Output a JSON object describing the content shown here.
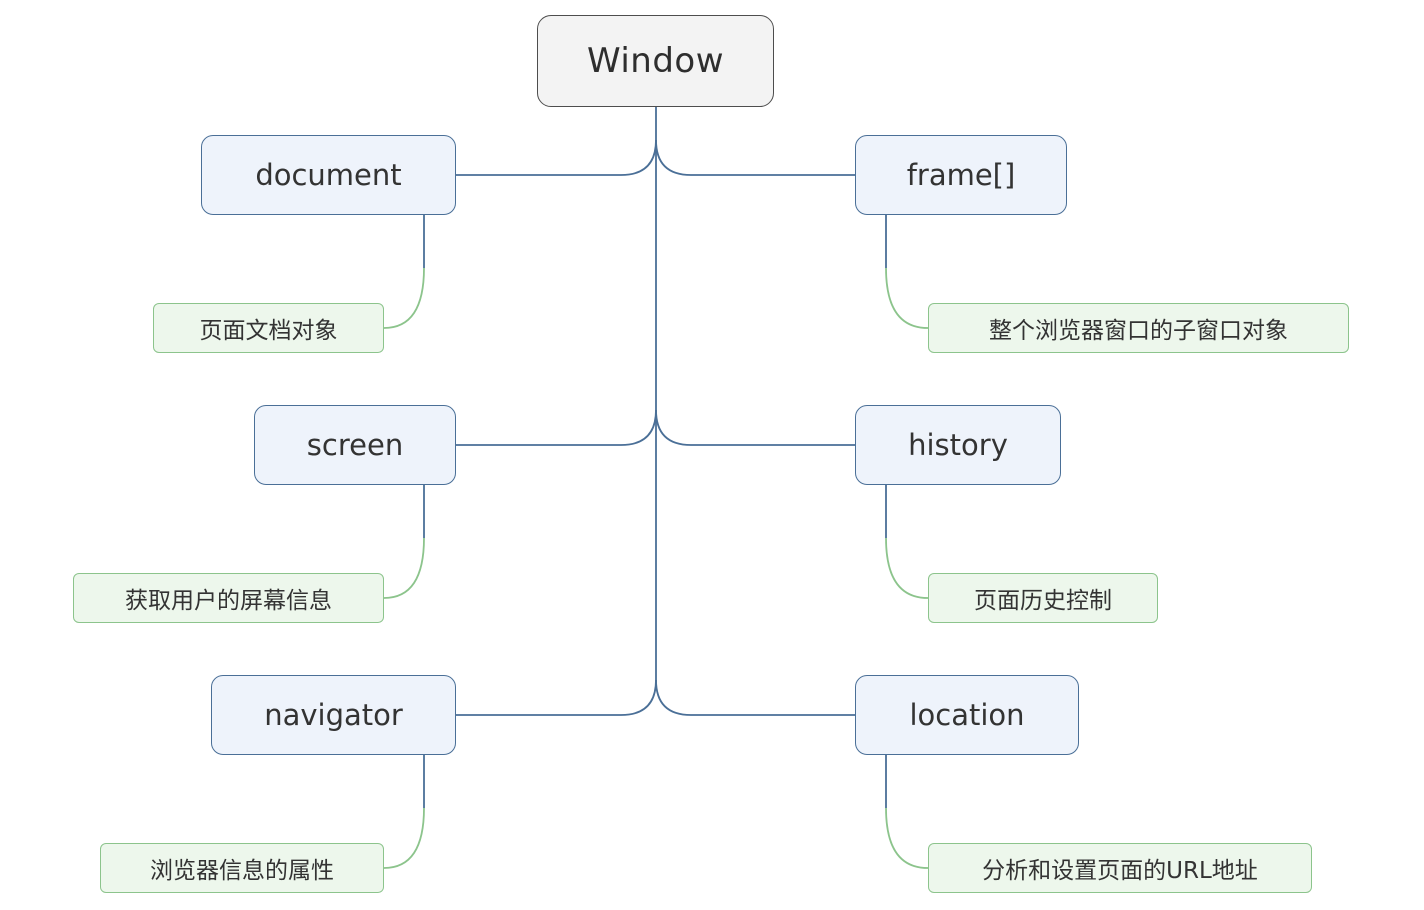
{
  "root": {
    "label": "Window"
  },
  "objects": {
    "document": {
      "label": "document",
      "desc": "页面文档对象"
    },
    "screen": {
      "label": "screen",
      "desc": "获取用户的屏幕信息"
    },
    "navigator": {
      "label": "navigator",
      "desc": "浏览器信息的属性"
    },
    "frame": {
      "label": "frame[]",
      "desc": "整个浏览器窗口的子窗口对象"
    },
    "history": {
      "label": "history",
      "desc": "页面历史控制"
    },
    "location": {
      "label": "location",
      "desc": "分析和设置页面的URL地址"
    }
  },
  "colors": {
    "root_border": "#4d4d4d",
    "root_fill": "#f3f3f3",
    "object_border": "#4a6f97",
    "object_fill": "#eef3fb",
    "desc_border": "#8cc48c",
    "desc_fill": "#edf7ec",
    "trunk_line": "#4a6f97",
    "desc_line": "#8cc48c"
  }
}
